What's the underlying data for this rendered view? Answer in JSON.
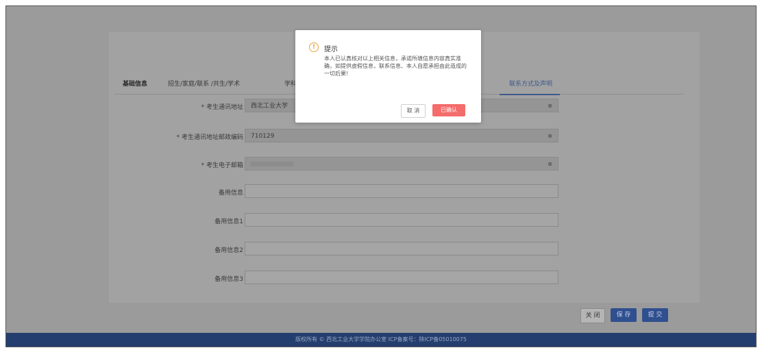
{
  "tabs": [
    "基础信息",
    "招生/家庭/联系 /共生/学术",
    "学科专",
    "联系方式及声明"
  ],
  "form": {
    "rows": [
      {
        "label": "* 考生通讯地址",
        "value": "西北工业大学",
        "dropdown": true
      },
      {
        "label": "* 考生通讯地址邮政编码",
        "value": "710129",
        "dropdown": true
      },
      {
        "label": "* 考生电子邮箱",
        "value": "",
        "dropdown": true,
        "masked": true
      },
      {
        "label": "备用信息",
        "value": ""
      },
      {
        "label": "备用信息1",
        "value": ""
      },
      {
        "label": "备用信息2",
        "value": ""
      },
      {
        "label": "备用信息3",
        "value": ""
      }
    ]
  },
  "actions": {
    "back": "关 闭",
    "save": "保 存",
    "submit": "提 交"
  },
  "footer": "版权所有 © 西北工业大学学院办公室 ICP备案号：陕ICP备05010075",
  "dialog": {
    "title": "提示",
    "message": "本人已认真核对以上相关信息，承诺所填信息内容真实准确，如提供虚假信息，联系信息、本人自愿承担由此造成的一切后果!",
    "cancel": "取 消",
    "confirm": "已确认"
  },
  "colors": {
    "primary": "#2f4f8f",
    "danger": "#f56c6c",
    "warning": "#e6a23c"
  }
}
